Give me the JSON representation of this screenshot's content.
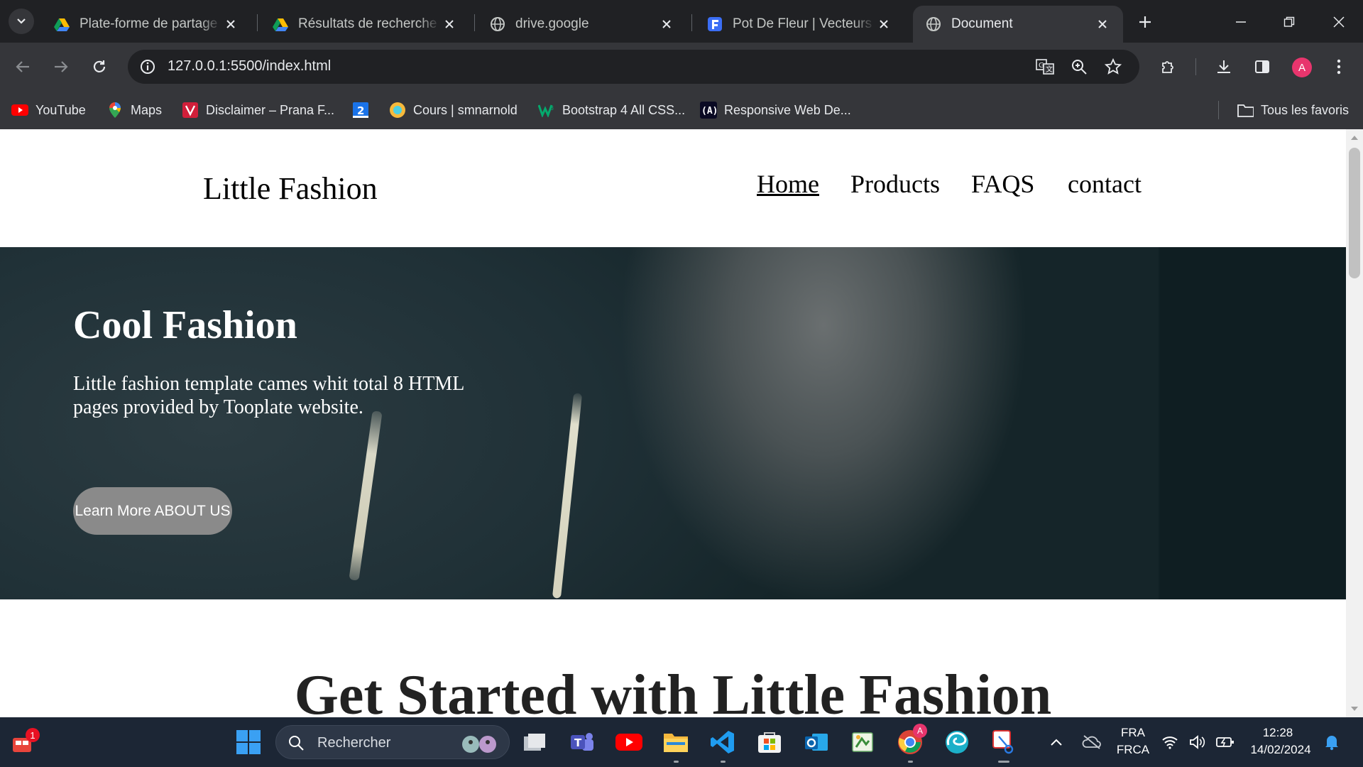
{
  "browser": {
    "tabs": [
      {
        "title": "Plate-forme de partage de",
        "icon": "google-drive-icon"
      },
      {
        "title": "Résultats de recherche - G",
        "icon": "google-drive-icon"
      },
      {
        "title": "drive.google",
        "icon": "globe-icon"
      },
      {
        "title": "Pot De Fleur | Vecteurs et P",
        "icon": "freepik-icon"
      },
      {
        "title": "Document",
        "icon": "globe-icon",
        "active": true
      }
    ],
    "url": "127.0.0.1:5500/index.html",
    "profile_initial": "A",
    "bookmarks": [
      {
        "label": "YouTube",
        "icon": "youtube-icon"
      },
      {
        "label": "Maps",
        "icon": "maps-icon"
      },
      {
        "label": "Disclaimer – Prana F...",
        "icon": "prana-icon"
      },
      {
        "label": "2",
        "icon": "bookmark-2-icon"
      },
      {
        "label": "Cours | smnarnold",
        "icon": "smnarnold-icon"
      },
      {
        "label": "Bootstrap 4 All CSS...",
        "icon": "w3-icon"
      },
      {
        "label": "Responsive Web De...",
        "icon": "freecodecamp-icon"
      }
    ],
    "all_bookmarks": "Tous les favoris"
  },
  "site": {
    "logo": "Little Fashion",
    "nav": [
      "Home",
      "Products",
      "FAQS",
      "contact"
    ],
    "hero": {
      "title": "Cool Fashion",
      "text": "Little fashion template cames whit total 8 HTML pages provided by Tooplate website.",
      "cta": "Learn More ABOUT US"
    },
    "section_title": "Get Started with Little Fashion"
  },
  "taskbar": {
    "search_placeholder": "Rechercher",
    "notification_badge": "1",
    "lang_top": "FRA",
    "lang_bottom": "FRCA",
    "time": "12:28",
    "date": "14/02/2024",
    "chrome_badge": "A"
  },
  "colors": {
    "chrome_dark": "#202124",
    "chrome_toolbar": "#35363a",
    "avatar": "#e8356d",
    "cta_button": "#8a8a8a",
    "taskbar": "#1c2635"
  }
}
